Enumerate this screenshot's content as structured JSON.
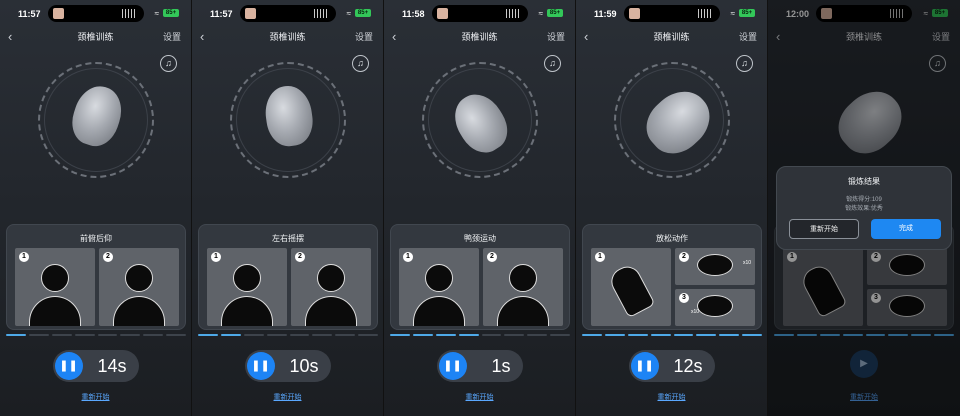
{
  "screens": [
    {
      "status": {
        "time": "11:57",
        "battery": "85+"
      },
      "nav": {
        "title": "颈椎训练",
        "settings": "设置"
      },
      "card": {
        "title": "前俯后仰",
        "tiles": [
          "1",
          "2"
        ]
      },
      "progress": [
        1,
        0,
        0,
        0,
        0,
        0,
        0,
        0
      ],
      "timer": "14s",
      "restart_link": "重新开始"
    },
    {
      "status": {
        "time": "11:57",
        "battery": "85+"
      },
      "nav": {
        "title": "颈椎训练",
        "settings": "设置"
      },
      "card": {
        "title": "左右摇摆",
        "tiles": [
          "1",
          "2"
        ]
      },
      "progress": [
        1,
        1,
        0,
        0,
        0,
        0,
        0,
        0
      ],
      "timer": "10s",
      "restart_link": "重新开始"
    },
    {
      "status": {
        "time": "11:58",
        "battery": "85+"
      },
      "nav": {
        "title": "颈椎训练",
        "settings": "设置"
      },
      "card": {
        "title": "鸭颈运动",
        "tiles": [
          "1",
          "2"
        ]
      },
      "progress": [
        1,
        1,
        1,
        1,
        0,
        0,
        0,
        0
      ],
      "timer": "1s",
      "restart_link": "重新开始"
    },
    {
      "status": {
        "time": "11:59",
        "battery": "85+"
      },
      "nav": {
        "title": "颈椎训练",
        "settings": "设置"
      },
      "card": {
        "title": "放松动作",
        "tiles": [
          "1",
          "2",
          "3"
        ],
        "counts": [
          "x10",
          "x10"
        ]
      },
      "progress": [
        1,
        1,
        1,
        1,
        1,
        1,
        1,
        1
      ],
      "timer": "12s",
      "restart_link": "重新开始"
    },
    {
      "status": {
        "time": "12:00",
        "battery": "85+"
      },
      "nav": {
        "title": "颈椎训练",
        "settings": "设置"
      },
      "card": {
        "tiles": [
          "1",
          "2",
          "3"
        ]
      },
      "progress": [
        1,
        1,
        1,
        1,
        1,
        1,
        1,
        1
      ],
      "restart_link": "重新开始",
      "modal": {
        "title": "锻炼结果",
        "score": "锻炼得分:109",
        "effect": "锻炼效果:优秀",
        "restart_button": "重新开始",
        "done_button": "完成"
      }
    }
  ],
  "colors": {
    "accent": "#1e88f2",
    "progress_on": "#4ea9e8",
    "battery": "#33c759"
  }
}
